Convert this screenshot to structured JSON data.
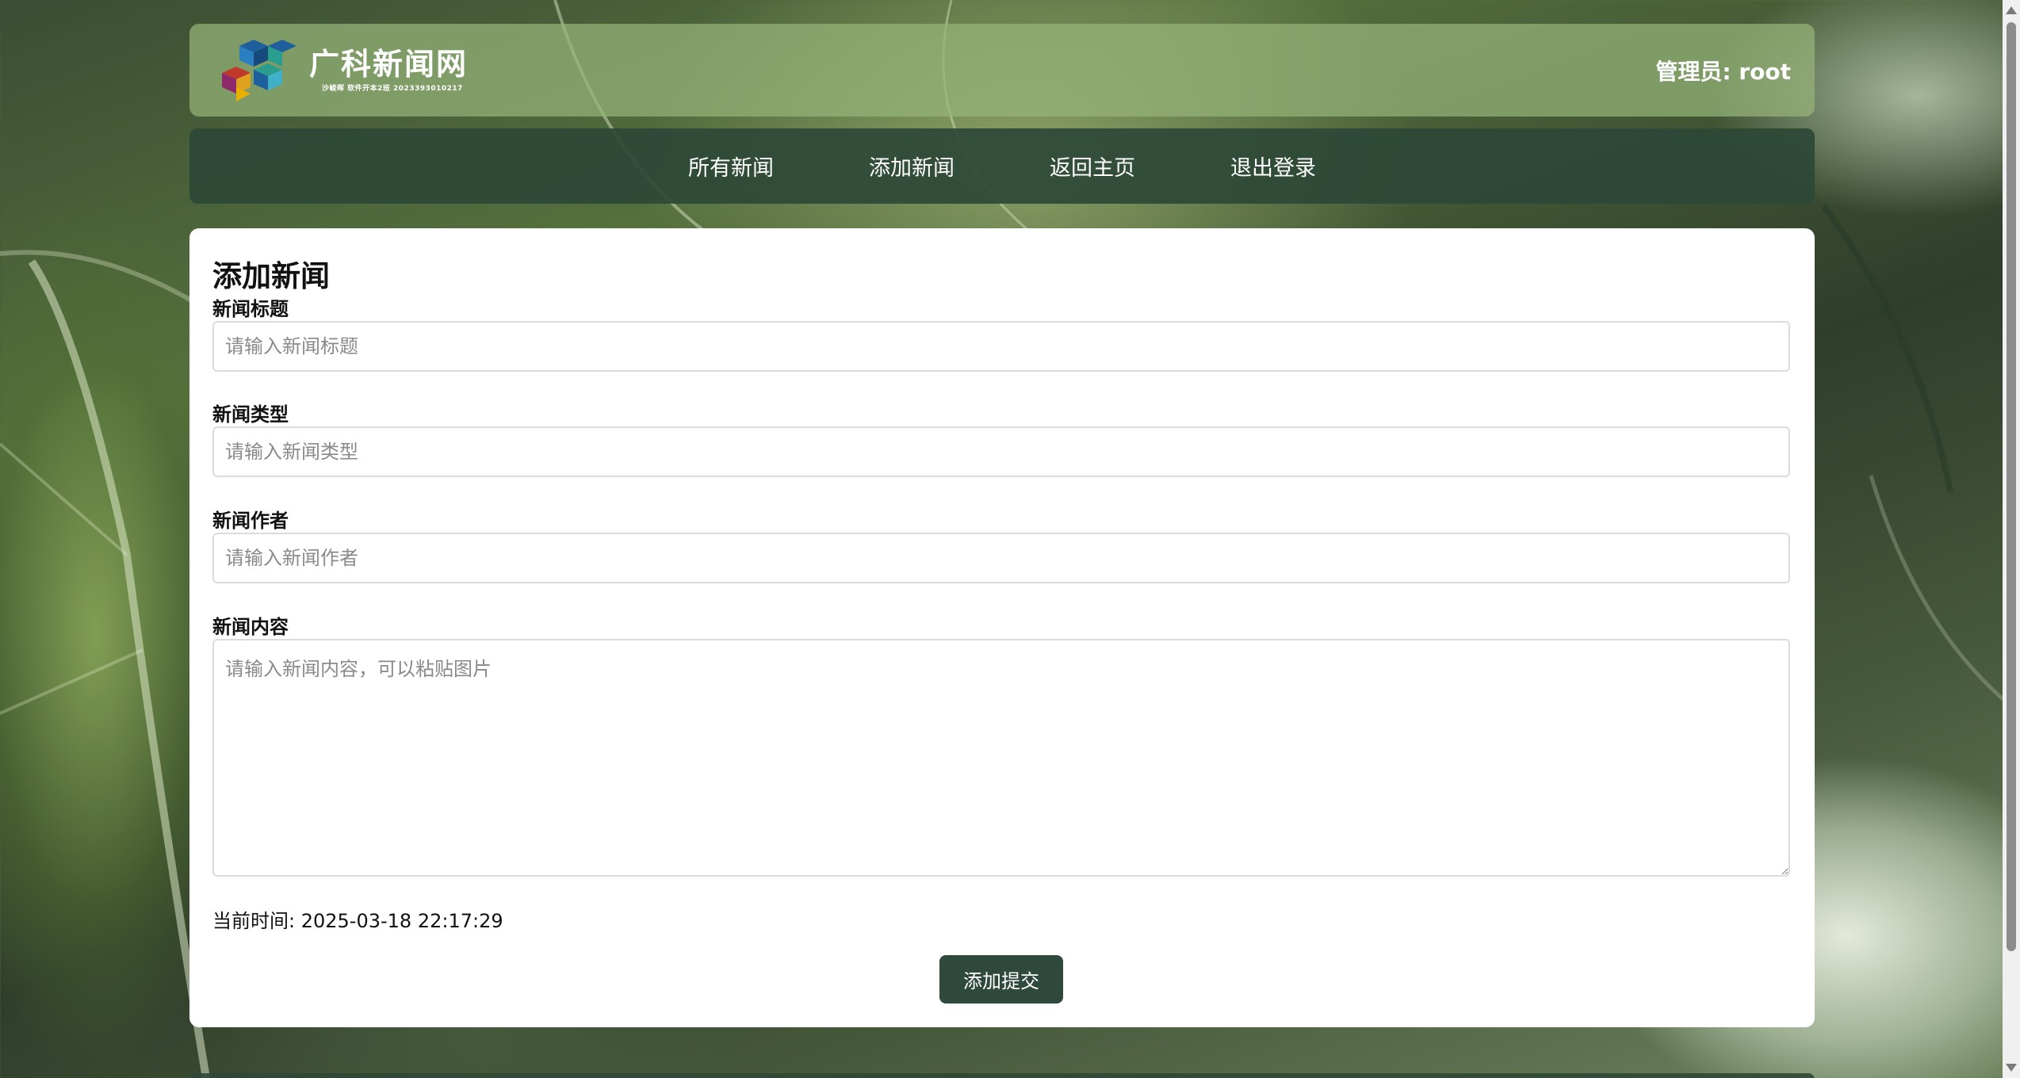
{
  "header": {
    "logo_title": "广科新闻网",
    "logo_subtitle": "沙峻晖 软件开本2班 2023393010217",
    "admin_label": "管理员: root"
  },
  "nav": {
    "items": [
      "所有新闻",
      "添加新闻",
      "返回主页",
      "退出登录"
    ]
  },
  "form": {
    "title": "添加新闻",
    "news_title_label": "新闻标题",
    "news_title_placeholder": "请输入新闻标题",
    "news_type_label": "新闻类型",
    "news_type_placeholder": "请输入新闻类型",
    "news_author_label": "新闻作者",
    "news_author_placeholder": "请输入新闻作者",
    "news_content_label": "新闻内容",
    "news_content_placeholder": "请输入新闻内容，可以粘贴图片",
    "current_time": "当前时间: 2025-03-18 22:17:29",
    "submit_label": "添加提交"
  },
  "colors": {
    "header_bg": "#96b478",
    "nav_bg": "#2d4837",
    "button_bg": "#2f4a3c"
  }
}
